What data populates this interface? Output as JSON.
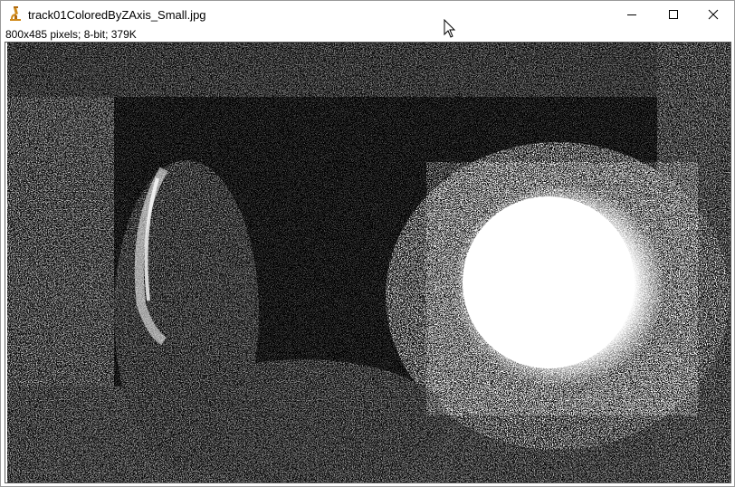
{
  "window": {
    "title": "track01ColoredByZAxis_Small.jpg",
    "icons": {
      "app": "microscope-icon",
      "minimize": "minimize-icon",
      "maximize": "maximize-icon",
      "close": "close-icon",
      "cursor": "mouse-pointer-icon"
    }
  },
  "image_info": {
    "text": "800x485 pixels; 8-bit; 379K"
  },
  "image_canvas": {
    "description_colors": {
      "background": "#000000",
      "foreground": "#ffffff"
    }
  }
}
